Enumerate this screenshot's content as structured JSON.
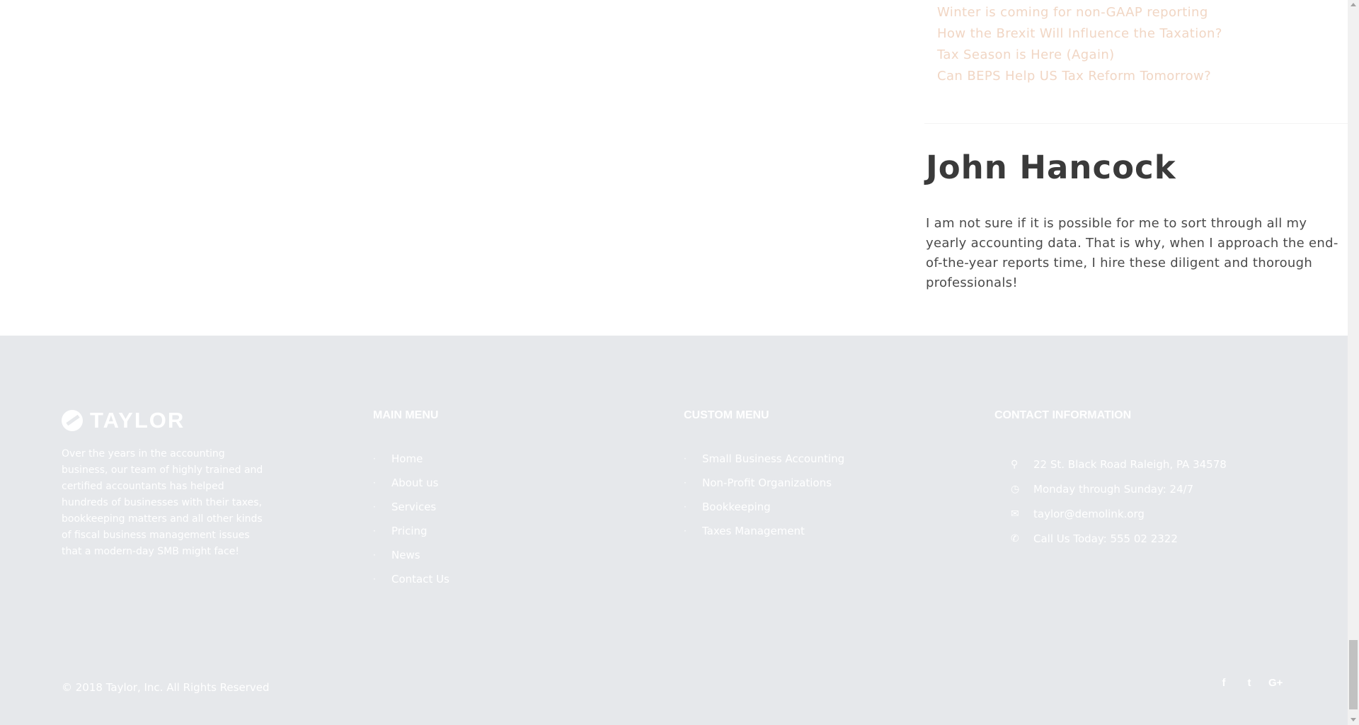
{
  "recent_posts": [
    "Winter is coming for non-GAAP reporting",
    "How the Brexit Will Influence the Taxation?",
    "Tax Season is Here (Again)",
    "Can BEPS Help US Tax Reform Tomorrow?"
  ],
  "testimonial": {
    "name": "John Hancock",
    "text": "I am not sure if it is possible for me to sort through all my yearly accounting data. That is why, when I approach the end-of-the-year reports time, I hire these diligent and thorough professionals!"
  },
  "footer": {
    "logo_text": "TAYLOR",
    "about": "Over the years in the accounting business, our team of highly trained and certified accountants has helped hundreds of businesses with their taxes, bookkeeping matters and all other kinds of fiscal business management issues that a modern-day SMB might face!",
    "main_menu": {
      "title": "MAIN MENU",
      "items": [
        "Home",
        "About us",
        "Services",
        "Pricing",
        "News",
        "Contact Us"
      ]
    },
    "custom_menu": {
      "title": "CUSTOM MENU",
      "items": [
        "Small Business Accounting",
        "Non-Profit Organizations",
        "Bookkeeping",
        "Taxes Management"
      ]
    },
    "contact": {
      "title": "CONTACT INFORMATION",
      "address": "22 St. Black Road Raleigh, PA 34578",
      "hours": "Monday through Sunday: 24/7",
      "email": "taylor@demolink.org",
      "phone": "Call Us Today: 555 02 2322"
    },
    "copyright": "© 2018 Taylor, Inc. All Rights Reserved",
    "social": [
      "facebook-icon",
      "twitter-icon",
      "google-plus-icon"
    ]
  },
  "colors": {
    "footer_bg": "#e6e8eb",
    "link_accent": "#f1d6c4",
    "heading": "#3a3a3a"
  }
}
